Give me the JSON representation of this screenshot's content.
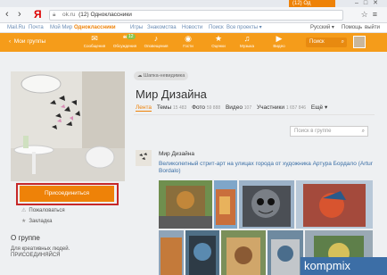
{
  "browser": {
    "tab_title": "(12) Од",
    "url_domain": "ok.ru",
    "url_title": "(12) Одноклассники",
    "logo": "Я"
  },
  "portal": {
    "items": [
      "Mail.Ru",
      "Почта",
      "Мой Мир",
      "Одноклассники",
      "Игры",
      "Знакомства",
      "Новости",
      "Поиск",
      "Все проекты ▾"
    ],
    "language": "Русский ▾",
    "help": "Помощь",
    "logout": "выйти"
  },
  "toolbar": {
    "my_groups": "Мои группы",
    "items": [
      {
        "label": "Сообщения",
        "icon": "message-icon"
      },
      {
        "label": "Обсуждения",
        "icon": "discussion-icon",
        "badge": "12"
      },
      {
        "label": "Оповещения",
        "icon": "bell-icon"
      },
      {
        "label": "Гости",
        "icon": "guests-icon"
      },
      {
        "label": "Оценки",
        "icon": "star-icon"
      },
      {
        "label": "Музыка",
        "icon": "music-icon"
      },
      {
        "label": "Видео",
        "icon": "video-icon"
      }
    ],
    "search_placeholder": "Поиск"
  },
  "group": {
    "breadcrumb": "Шапка-невидимка",
    "title": "Мир Дизайна",
    "tabs": [
      {
        "label": "Лента",
        "count": ""
      },
      {
        "label": "Темы",
        "count": "15 483"
      },
      {
        "label": "Фото",
        "count": "59 888"
      },
      {
        "label": "Видео",
        "count": "107"
      },
      {
        "label": "Участники",
        "count": "1 657 846"
      },
      {
        "label": "Ещё ▾",
        "count": ""
      }
    ],
    "search_placeholder": "Поиск в группе",
    "join_label": "Присоединиться",
    "complain": "Пожаловаться",
    "bookmark": "Закладка",
    "about_title": "О группе",
    "about_text": "Для креативных людей. ПРИСОЕДИНЯЙСЯ"
  },
  "post": {
    "author": "Мир Дизайна",
    "text": "Великолепный стрит-арт на улицах города от художника Артура Бордало (Artur Bordalo)"
  },
  "watermark": {
    "text": "kompmix"
  },
  "colors": {
    "accent": "#ee8208",
    "toolbar": "#f59c1a",
    "frame": "#c62828"
  }
}
